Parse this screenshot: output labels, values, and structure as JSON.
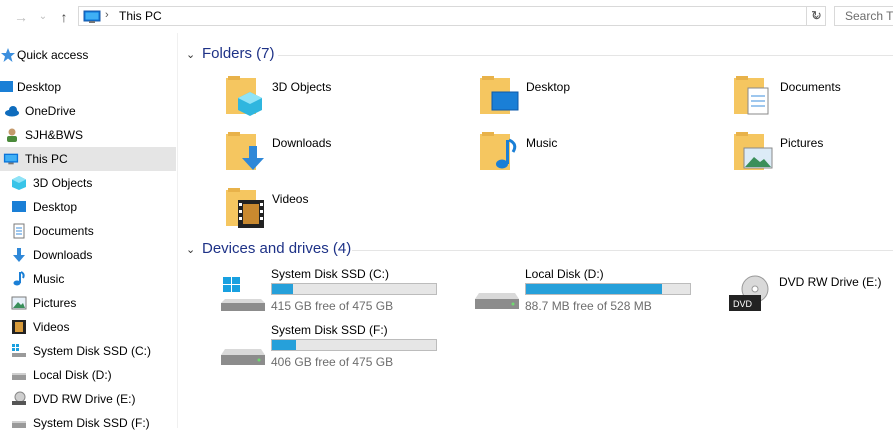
{
  "address": {
    "location": "This PC",
    "search_placeholder": "Search This PC"
  },
  "nav": {
    "items": [
      {
        "label": "Quick access",
        "icon": "star-icon"
      },
      {
        "label": "Desktop",
        "icon": "desktop-icon"
      },
      {
        "label": "OneDrive",
        "icon": "onedrive-cloud-icon"
      },
      {
        "label": "SJH&BWS",
        "icon": "user-folder-icon"
      },
      {
        "label": "This PC",
        "icon": "this-pc-icon"
      },
      {
        "label": "3D Objects",
        "icon": "3d-objects-icon"
      },
      {
        "label": "Desktop",
        "icon": "desktop-icon"
      },
      {
        "label": "Documents",
        "icon": "documents-icon"
      },
      {
        "label": "Downloads",
        "icon": "downloads-icon"
      },
      {
        "label": "Music",
        "icon": "music-icon"
      },
      {
        "label": "Pictures",
        "icon": "pictures-icon"
      },
      {
        "label": "Videos",
        "icon": "videos-icon"
      },
      {
        "label": "System Disk SSD (C:)",
        "icon": "drive-icon"
      },
      {
        "label": "Local Disk (D:)",
        "icon": "drive-icon"
      },
      {
        "label": "DVD RW Drive (E:)",
        "icon": "dvd-drive-icon"
      },
      {
        "label": "System Disk SSD (F:)",
        "icon": "drive-icon"
      }
    ],
    "selected": "This PC"
  },
  "folders_group": {
    "title": "Folders (7)"
  },
  "folders": [
    {
      "label": "3D Objects",
      "icon": "3d-objects-folder-icon"
    },
    {
      "label": "Desktop",
      "icon": "desktop-folder-icon"
    },
    {
      "label": "Documents",
      "icon": "documents-folder-icon"
    },
    {
      "label": "Downloads",
      "icon": "downloads-folder-icon"
    },
    {
      "label": "Music",
      "icon": "music-folder-icon"
    },
    {
      "label": "Pictures",
      "icon": "pictures-folder-icon"
    },
    {
      "label": "Videos",
      "icon": "videos-folder-icon"
    }
  ],
  "drives_group": {
    "title": "Devices and drives (4)"
  },
  "drives": [
    {
      "name": "System Disk SSD (C:)",
      "free": "415 GB free of 475 GB",
      "used_fraction": 0.126,
      "icon": "windows-drive-icon"
    },
    {
      "name": "Local Disk (D:)",
      "free": "88.7 MB free of 528 MB",
      "used_fraction": 0.832,
      "icon": "drive-icon"
    },
    {
      "name": "DVD RW Drive (E:)",
      "free": "",
      "used_fraction": null,
      "icon": "dvd-drive-icon"
    },
    {
      "name": "System Disk SSD (F:)",
      "free": "406 GB free of 475 GB",
      "used_fraction": 0.145,
      "icon": "drive-icon"
    }
  ],
  "colors": {
    "bar_fill": "#26a0da",
    "group_title": "#1e3287",
    "selected_bg": "#e5e5e5"
  }
}
